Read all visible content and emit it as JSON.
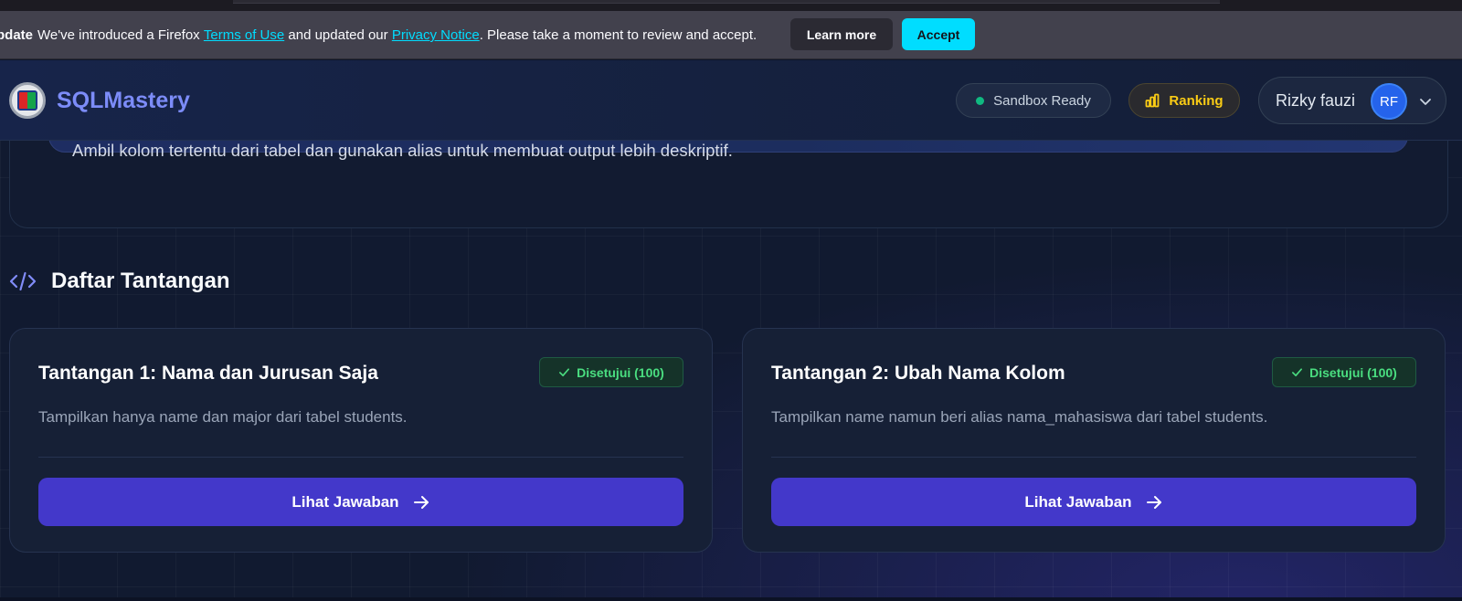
{
  "notification": {
    "lead": "pdate",
    "text_1": "We've introduced a Firefox ",
    "terms_link": "Terms of Use",
    "text_2": " and updated our ",
    "privacy_link": "Privacy Notice",
    "text_3": ". Please take a moment to review and accept.",
    "learn_more_label": "Learn more",
    "accept_label": "Accept",
    "link_color": "#00ddff",
    "accept_color": "#00ddff"
  },
  "header": {
    "brand": "SQLMastery",
    "brand_color": "#7c8cf8",
    "sandbox_status": "Sandbox Ready",
    "ranking_label": "Ranking",
    "user_name": "Rizky fauzi",
    "user_initials": "RF",
    "icons": [
      "university-logo-icon",
      "status-dot-icon",
      "bar-chart-icon",
      "chevron-down-icon"
    ]
  },
  "hero": {
    "description": "Ambil kolom tertentu dari tabel dan gunakan alias untuk membuat output lebih deskriptif."
  },
  "section": {
    "title": "Daftar Tantangan",
    "icon": "code-icon"
  },
  "challenges": [
    {
      "title": "Tantangan 1: Nama dan Jurusan Saja",
      "status": "Disetujui (100)",
      "description": "Tampilkan hanya name dan major dari tabel students.",
      "button_label": "Lihat Jawaban"
    },
    {
      "title": "Tantangan 2: Ubah Nama Kolom",
      "status": "Disetujui (100)",
      "description": "Tampilkan name namun beri alias nama_mahasiswa dari tabel students.",
      "button_label": "Lihat Jawaban"
    }
  ],
  "colors": {
    "primary_button": "#4338ca",
    "success_badge_text": "#4ade80",
    "ranking_text": "#facc15",
    "avatar_bg": "#2563eb"
  }
}
